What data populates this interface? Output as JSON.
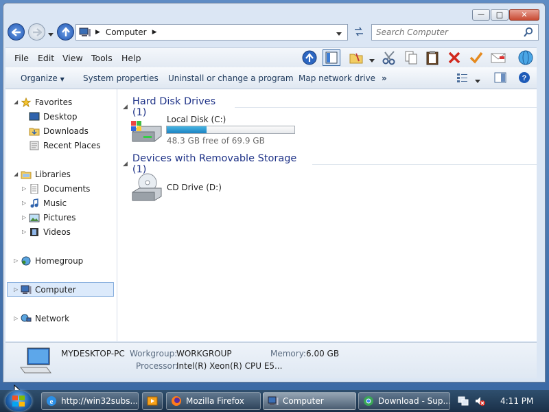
{
  "window": {
    "minimize_glyph": "—",
    "maximize_glyph": "□",
    "close_glyph": "✕"
  },
  "address": {
    "location": "Computer"
  },
  "search": {
    "placeholder": "Search Computer"
  },
  "menu": {
    "file": "File",
    "edit": "Edit",
    "view": "View",
    "tools": "Tools",
    "help": "Help"
  },
  "commands": {
    "organize": "Organize",
    "system_properties": "System properties",
    "uninstall": "Uninstall or change a program",
    "map_drive": "Map network drive",
    "more": "»"
  },
  "nav": {
    "favorites": "Favorites",
    "desktop": "Desktop",
    "downloads": "Downloads",
    "recent_places": "Recent Places",
    "libraries": "Libraries",
    "documents": "Documents",
    "music": "Music",
    "pictures": "Pictures",
    "videos": "Videos",
    "homegroup": "Homegroup",
    "computer": "Computer",
    "network": "Network"
  },
  "groups": {
    "hard_disk": {
      "title": "Hard Disk Drives (1)"
    },
    "removable": {
      "title": "Devices with Removable Storage (1)"
    }
  },
  "drives": {
    "local": {
      "name": "Local Disk (C:)",
      "free_text": "48.3 GB free of 69.9 GB",
      "used_fraction": 0.31
    },
    "cd": {
      "name": "CD Drive (D:)"
    }
  },
  "details": {
    "pc_name": "MYDESKTOP-PC",
    "workgroup_label": "Workgroup:",
    "workgroup": "WORKGROUP",
    "memory_label": "Memory:",
    "memory": "6.00 GB",
    "processor_label": "Processor:",
    "processor": "Intel(R) Xeon(R) CPU E5..."
  },
  "taskbar": {
    "ie": "http://win32subs...",
    "firefox": "Mozilla Firefox",
    "computer": "Computer",
    "download": "Download - Sup...",
    "clock": "4:11 PM"
  }
}
